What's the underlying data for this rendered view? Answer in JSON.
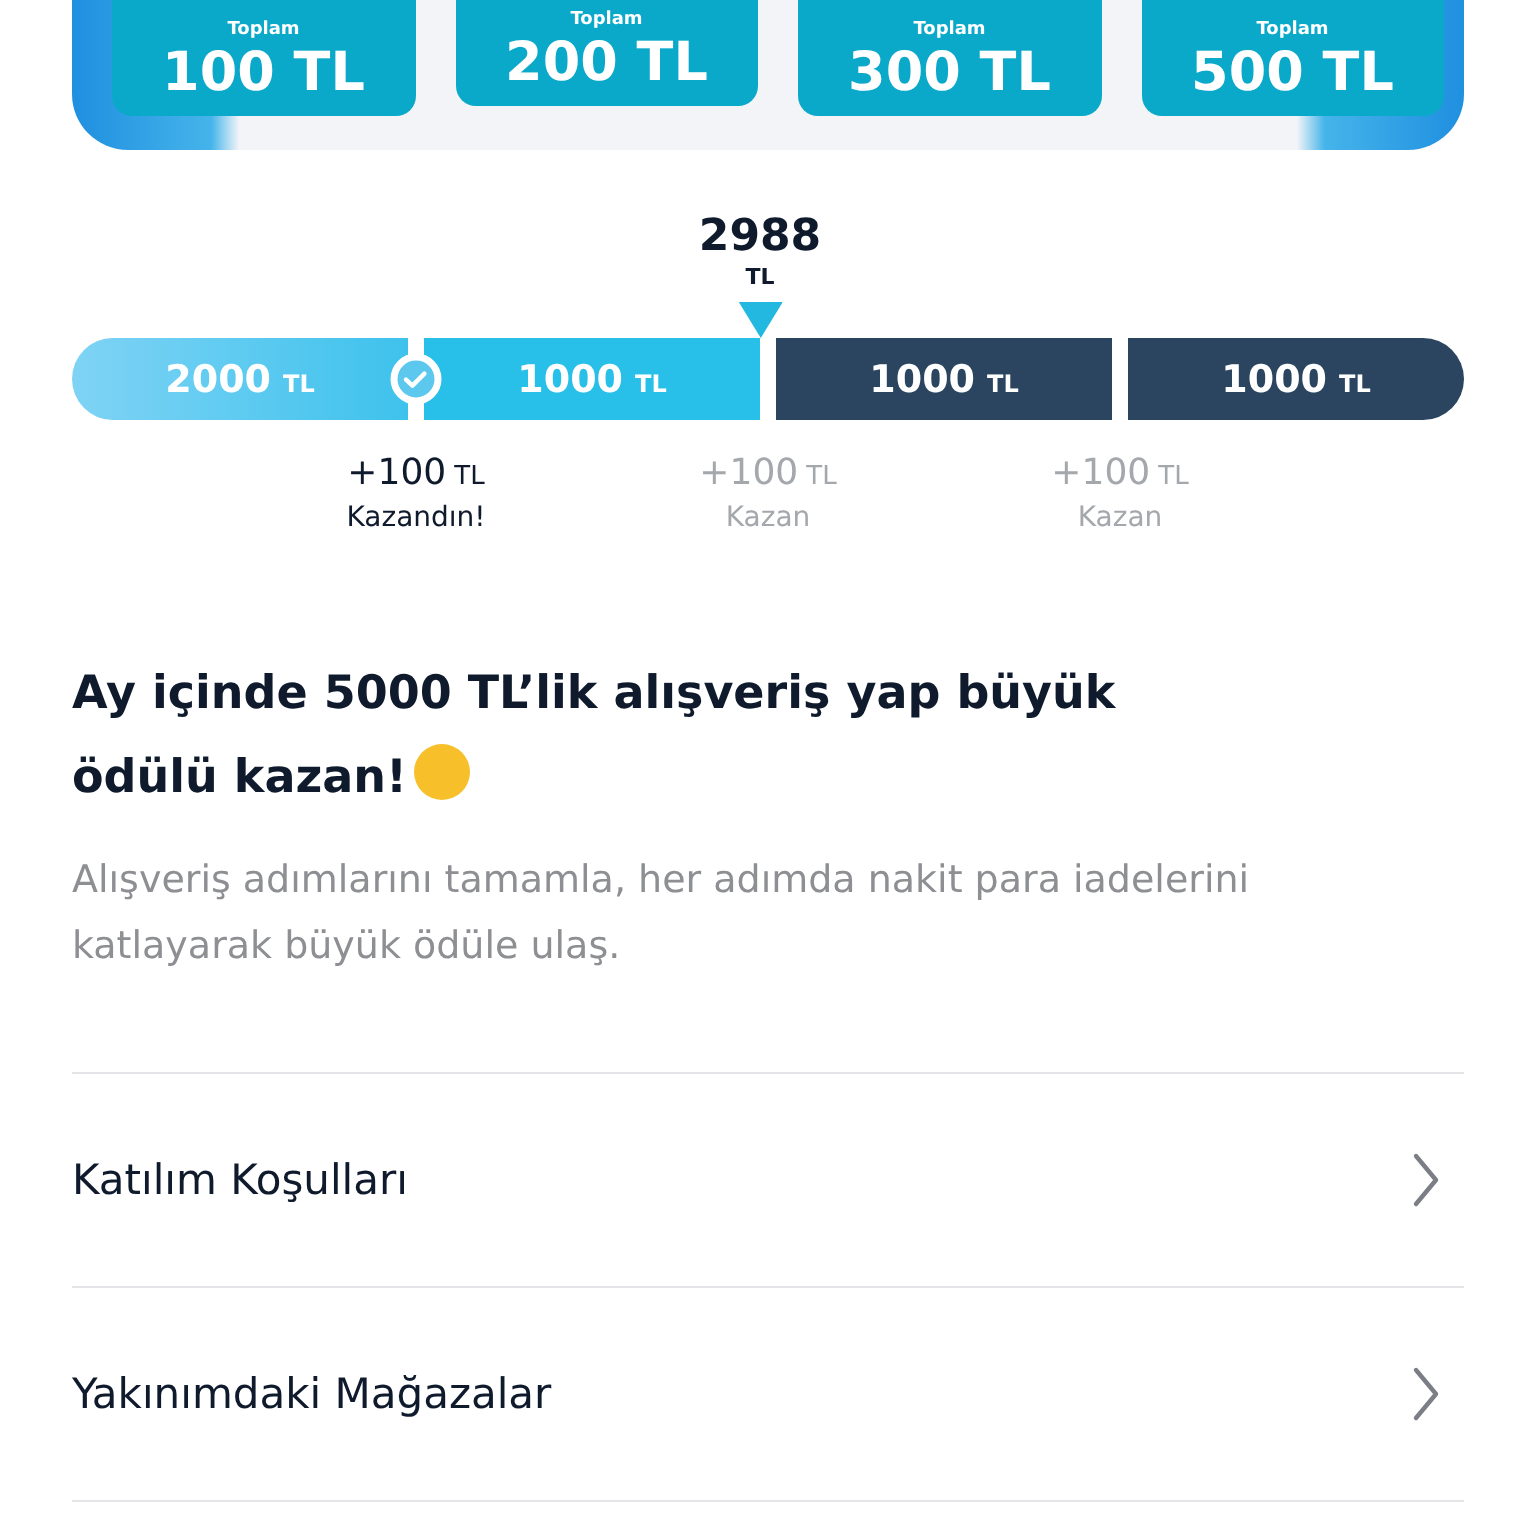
{
  "totals": [
    {
      "caption": "Toplam",
      "amount": "100 TL"
    },
    {
      "caption": "Toplam",
      "amount": "200 TL"
    },
    {
      "caption": "Toplam",
      "amount": "300 TL"
    },
    {
      "caption": "Toplam",
      "amount": "500 TL"
    }
  ],
  "progress": {
    "current": {
      "value": "2988",
      "unit": "TL"
    },
    "segments": [
      {
        "amount": "2000",
        "unit": "TL",
        "filled": true
      },
      {
        "amount": "1000",
        "unit": "TL",
        "filled": true
      },
      {
        "amount": "1000",
        "unit": "TL",
        "filled": false
      },
      {
        "amount": "1000",
        "unit": "TL",
        "filled": false
      }
    ],
    "milestones": [
      {
        "reward": "+100",
        "unit": "TL",
        "label": "Kazandın!",
        "achieved": true
      },
      {
        "reward": "+100",
        "unit": "TL",
        "label": "Kazan",
        "achieved": false
      },
      {
        "reward": "+100",
        "unit": "TL",
        "label": "Kazan",
        "achieved": false
      }
    ]
  },
  "title": "Ay içinde 5000 TL’lik alışveriş yap büyük ödülü kazan!",
  "description": "Alışveriş adımlarını tamamla, her adımda nakit para iadelerini katlayarak büyük ödüle ulaş.",
  "menu": [
    {
      "label": "Katılım Koşulları"
    },
    {
      "label": "Yakınımdaki Mağazalar"
    }
  ]
}
